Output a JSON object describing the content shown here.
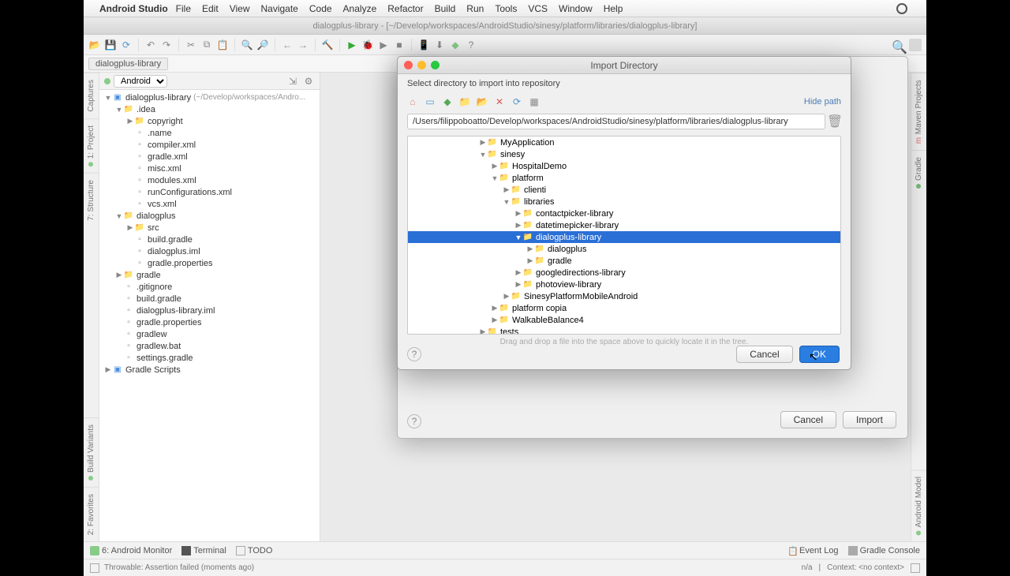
{
  "menubar": {
    "app": "Android Studio",
    "items": [
      "File",
      "Edit",
      "View",
      "Navigate",
      "Code",
      "Analyze",
      "Refactor",
      "Build",
      "Run",
      "Tools",
      "VCS",
      "Window",
      "Help"
    ]
  },
  "window_title": "dialogplus-library - [~/Develop/workspaces/AndroidStudio/sinesy/platform/libraries/dialogplus-library]",
  "breadcrumb": "dialogplus-library",
  "panel": {
    "selector": "Android"
  },
  "side_tabs_left": [
    "Captures",
    "1: Project",
    "7: Structure",
    "Build Variants",
    "2: Favorites"
  ],
  "side_tabs_right": [
    "Maven Projects",
    "Gradle",
    "Android Model"
  ],
  "project_tree": [
    {
      "d": 0,
      "a": "▼",
      "i": "module",
      "t": "dialogplus-library",
      "dim": "(~/Develop/workspaces/Andro..."
    },
    {
      "d": 1,
      "a": "▼",
      "i": "folder",
      "t": ".idea"
    },
    {
      "d": 2,
      "a": "▶",
      "i": "folder",
      "t": "copyright"
    },
    {
      "d": 2,
      "a": "",
      "i": "file",
      "t": ".name"
    },
    {
      "d": 2,
      "a": "",
      "i": "file",
      "t": "compiler.xml"
    },
    {
      "d": 2,
      "a": "",
      "i": "file",
      "t": "gradle.xml"
    },
    {
      "d": 2,
      "a": "",
      "i": "file",
      "t": "misc.xml"
    },
    {
      "d": 2,
      "a": "",
      "i": "file",
      "t": "modules.xml"
    },
    {
      "d": 2,
      "a": "",
      "i": "file",
      "t": "runConfigurations.xml"
    },
    {
      "d": 2,
      "a": "",
      "i": "file",
      "t": "vcs.xml"
    },
    {
      "d": 1,
      "a": "▼",
      "i": "folder",
      "t": "dialogplus"
    },
    {
      "d": 2,
      "a": "▶",
      "i": "folder",
      "t": "src"
    },
    {
      "d": 2,
      "a": "",
      "i": "file",
      "t": "build.gradle"
    },
    {
      "d": 2,
      "a": "",
      "i": "file",
      "t": "dialogplus.iml"
    },
    {
      "d": 2,
      "a": "",
      "i": "file",
      "t": "gradle.properties"
    },
    {
      "d": 1,
      "a": "▶",
      "i": "folder",
      "t": "gradle"
    },
    {
      "d": 1,
      "a": "",
      "i": "file",
      "t": ".gitignore"
    },
    {
      "d": 1,
      "a": "",
      "i": "file",
      "t": "build.gradle"
    },
    {
      "d": 1,
      "a": "",
      "i": "file",
      "t": "dialogplus-library.iml"
    },
    {
      "d": 1,
      "a": "",
      "i": "file",
      "t": "gradle.properties"
    },
    {
      "d": 1,
      "a": "",
      "i": "file",
      "t": "gradlew"
    },
    {
      "d": 1,
      "a": "",
      "i": "file",
      "t": "gradlew.bat"
    },
    {
      "d": 1,
      "a": "",
      "i": "file",
      "t": "settings.gradle"
    },
    {
      "d": 0,
      "a": "▶",
      "i": "module",
      "t": "Gradle Scripts"
    }
  ],
  "bottom": {
    "monitor": "6: Android Monitor",
    "terminal": "Terminal",
    "todo": "TODO",
    "eventlog": "Event Log",
    "gradle": "Gradle Console"
  },
  "status": {
    "msg": "Throwable: Assertion failed (moments ago)",
    "encoding": "n/a",
    "context": "Context: <no context>"
  },
  "outer_dialog": {
    "cancel": "Cancel",
    "import": "Import"
  },
  "inner_dialog": {
    "title": "Import Directory",
    "subtitle": "Select directory to import into repository",
    "hide_path": "Hide path",
    "path": "/Users/filippoboatto/Develop/workspaces/AndroidStudio/sinesy/platform/libraries/dialogplus-library",
    "drag_hint": "Drag and drop a file into the space above to quickly locate it in the tree.",
    "cancel": "Cancel",
    "ok": "OK",
    "tree": [
      {
        "d": 6,
        "a": "▶",
        "t": "MyApplication"
      },
      {
        "d": 6,
        "a": "▼",
        "t": "sinesy"
      },
      {
        "d": 7,
        "a": "▶",
        "t": "HospitalDemo"
      },
      {
        "d": 7,
        "a": "▼",
        "t": "platform"
      },
      {
        "d": 8,
        "a": "▶",
        "t": "clienti"
      },
      {
        "d": 8,
        "a": "▼",
        "t": "libraries"
      },
      {
        "d": 9,
        "a": "▶",
        "t": "contactpicker-library"
      },
      {
        "d": 9,
        "a": "▶",
        "t": "datetimepicker-library"
      },
      {
        "d": 9,
        "a": "▼",
        "t": "dialogplus-library",
        "sel": true
      },
      {
        "d": 10,
        "a": "▶",
        "t": "dialogplus"
      },
      {
        "d": 10,
        "a": "▶",
        "t": "gradle"
      },
      {
        "d": 9,
        "a": "▶",
        "t": "googledirections-library"
      },
      {
        "d": 9,
        "a": "▶",
        "t": "photoview-library"
      },
      {
        "d": 8,
        "a": "▶",
        "t": "SinesyPlatformMobileAndroid"
      },
      {
        "d": 7,
        "a": "▶",
        "t": "platform copia"
      },
      {
        "d": 7,
        "a": "▶",
        "t": "WalkableBalance4"
      },
      {
        "d": 6,
        "a": "▶",
        "t": "tests"
      }
    ]
  }
}
